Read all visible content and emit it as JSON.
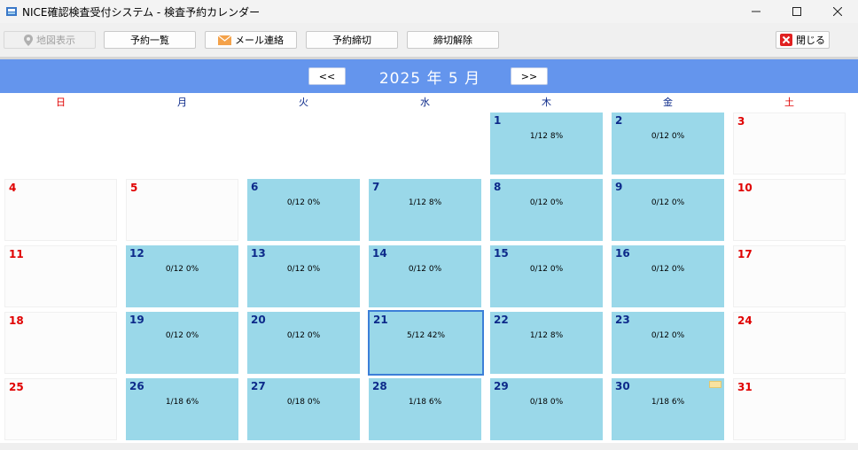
{
  "window": {
    "title": "NICE確認検査受付システム - 検査予約カレンダー"
  },
  "toolbar": {
    "map_label": "地図表示",
    "reservation_list_label": "予約一覧",
    "mail_label": "メール連絡",
    "reservation_deadline_label": "予約締切",
    "cancel_deadline_label": "締切解除",
    "close_label": "閉じる"
  },
  "calendar": {
    "prev_label": "<<",
    "next_label": ">>",
    "month_label": "2025 年 5 月",
    "weekdays": [
      "日",
      "月",
      "火",
      "水",
      "木",
      "金",
      "土"
    ],
    "days": {
      "d1": {
        "num": "1",
        "stat": "1/12 8%"
      },
      "d2": {
        "num": "2",
        "stat": "0/12 0%"
      },
      "d3": {
        "num": "3"
      },
      "d4": {
        "num": "4"
      },
      "d5": {
        "num": "5"
      },
      "d6": {
        "num": "6",
        "stat": "0/12 0%"
      },
      "d7": {
        "num": "7",
        "stat": "1/12 8%"
      },
      "d8": {
        "num": "8",
        "stat": "0/12 0%"
      },
      "d9": {
        "num": "9",
        "stat": "0/12 0%"
      },
      "d10": {
        "num": "10"
      },
      "d11": {
        "num": "11"
      },
      "d12": {
        "num": "12",
        "stat": "0/12 0%"
      },
      "d13": {
        "num": "13",
        "stat": "0/12 0%"
      },
      "d14": {
        "num": "14",
        "stat": "0/12 0%"
      },
      "d15": {
        "num": "15",
        "stat": "0/12 0%"
      },
      "d16": {
        "num": "16",
        "stat": "0/12 0%"
      },
      "d17": {
        "num": "17"
      },
      "d18": {
        "num": "18"
      },
      "d19": {
        "num": "19",
        "stat": "0/12 0%"
      },
      "d20": {
        "num": "20",
        "stat": "0/12 0%"
      },
      "d21": {
        "num": "21",
        "stat": "5/12 42%"
      },
      "d22": {
        "num": "22",
        "stat": "1/12 8%"
      },
      "d23": {
        "num": "23",
        "stat": "0/12 0%"
      },
      "d24": {
        "num": "24"
      },
      "d25": {
        "num": "25"
      },
      "d26": {
        "num": "26",
        "stat": "1/18 6%"
      },
      "d27": {
        "num": "27",
        "stat": "0/18 0%"
      },
      "d28": {
        "num": "28",
        "stat": "1/18 6%"
      },
      "d29": {
        "num": "29",
        "stat": "0/18 0%"
      },
      "d30": {
        "num": "30",
        "stat": "1/18 6%"
      },
      "d31": {
        "num": "31"
      }
    }
  },
  "colors": {
    "header_blue": "#6495ed",
    "available_cell": "#9ad8e9",
    "holiday_red": "#e00000",
    "day_number_blue": "#0d2a8a"
  }
}
